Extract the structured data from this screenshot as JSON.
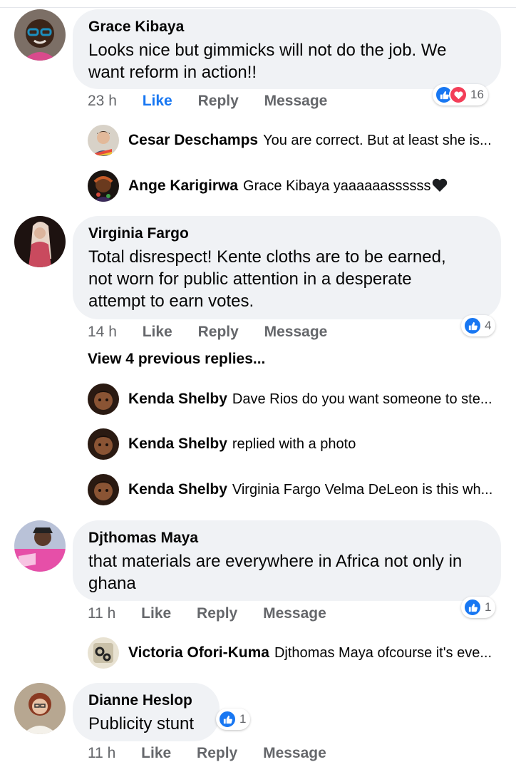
{
  "comments": [
    {
      "author": "Grace Kibaya",
      "text": "Looks nice but gimmicks will not do the job. We want reform in action!!",
      "time": "23 h",
      "like": "Like",
      "reply": "Reply",
      "message": "Message",
      "reaction_count": "16",
      "reactions": [
        "like-icon",
        "love-icon"
      ],
      "liked_by_viewer": true
    },
    {
      "author": "Virginia Fargo",
      "text": "Total disrespect! Kente cloths are to be earned, not worn for public attention in a desperate attempt to earn votes.",
      "time": "14 h",
      "like": "Like",
      "reply": "Reply",
      "message": "Message",
      "reaction_count": "4",
      "reactions": [
        "like-icon"
      ]
    },
    {
      "author": "Djthomas Maya",
      "text": "that materials are everywhere  in Africa not only in ghana",
      "time": "11 h",
      "like": "Like",
      "reply": "Reply",
      "message": "Message",
      "reaction_count": "1",
      "reactions": [
        "like-icon"
      ]
    },
    {
      "author": "Dianne Heslop",
      "text": "Publicity stunt",
      "time": "11 h",
      "like": "Like",
      "reply": "Reply",
      "message": "Message",
      "reaction_count": "1",
      "reactions": [
        "like-icon"
      ]
    }
  ],
  "replies": [
    {
      "author": "Cesar Deschamps",
      "text": "You are correct. But at least she is..."
    },
    {
      "author": "Ange Karigirwa",
      "text": "Grace Kibaya yaaaaaassssss",
      "trailing_icon": "black-heart-icon"
    },
    {
      "author": "Kenda Shelby",
      "text": "Dave Rios do you want someone to ste..."
    },
    {
      "author": "Kenda Shelby",
      "text": "replied with a photo"
    },
    {
      "author": "Kenda Shelby",
      "text": "Virginia Fargo Velma DeLeon is this wh..."
    },
    {
      "author": "Victoria Ofori-Kuma",
      "text": "Djthomas Maya ofcourse it's eve..."
    }
  ],
  "view_previous_replies": "View 4 previous replies...",
  "colors": {
    "accent": "#1877f2",
    "bubble": "#f0f2f5",
    "secondary_text": "#65676b",
    "love": "#f33e58"
  }
}
